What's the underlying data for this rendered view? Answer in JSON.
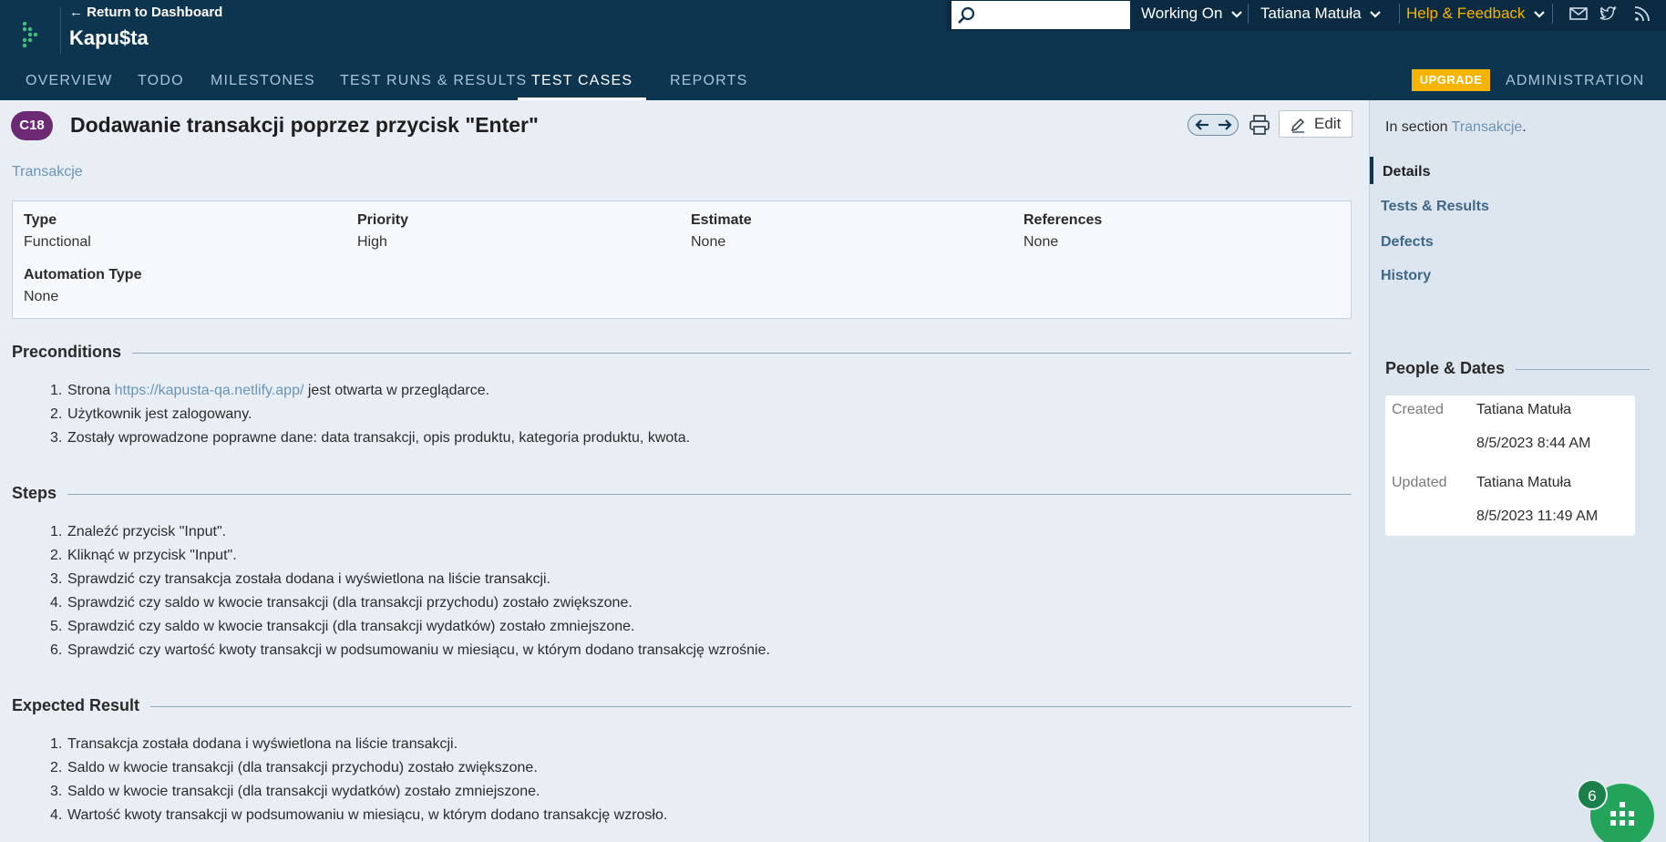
{
  "header": {
    "return_link": "← Return to Dashboard",
    "project_name": "Kapu$ta",
    "search": {
      "placeholder": ""
    },
    "menus": [
      {
        "label": "Working On"
      },
      {
        "label": "Tatiana Matuła"
      },
      {
        "label": "Help & Feedback"
      }
    ],
    "icons": [
      "mail-icon",
      "twitter-icon",
      "rss-icon"
    ],
    "nav": [
      {
        "label": "OVERVIEW"
      },
      {
        "label": "TODO"
      },
      {
        "label": "MILESTONES"
      },
      {
        "label": "TEST RUNS & RESULTS"
      },
      {
        "label": "TEST CASES",
        "active": true
      },
      {
        "label": "REPORTS"
      }
    ],
    "upgrade_label": "UPGRADE",
    "admin_label": "ADMINISTRATION"
  },
  "case": {
    "id": "C18",
    "title": "Dodawanie transakcji poprzez przycisk \"Enter\"",
    "edit_label": "Edit",
    "section": "Transakcje",
    "fields": {
      "type_label": "Type",
      "type_value": "Functional",
      "priority_label": "Priority",
      "priority_value": "High",
      "estimate_label": "Estimate",
      "estimate_value": "None",
      "references_label": "References",
      "references_value": "None",
      "automation_label": "Automation Type",
      "automation_value": "None"
    },
    "preconditions": {
      "heading": "Preconditions",
      "items": [
        {
          "num": "1.",
          "prefix": "Strona ",
          "link": "https://kapusta-qa.netlify.app/",
          "suffix": " jest otwarta w przeglądarce."
        },
        {
          "num": "2.",
          "text": "Użytkownik jest zalogowany."
        },
        {
          "num": "3.",
          "text": "Zostały wprowadzone poprawne dane: data transakcji, opis produktu, kategoria produktu, kwota."
        }
      ]
    },
    "steps": {
      "heading": "Steps",
      "items": [
        {
          "num": "1.",
          "text": "Znaleźć przycisk \"Input\"."
        },
        {
          "num": "2.",
          "text": "Kliknąć w przycisk \"Input\"."
        },
        {
          "num": "3.",
          "text": "Sprawdzić czy transakcja została dodana i wyświetlona na liście transakcji."
        },
        {
          "num": "4.",
          "text": "Sprawdzić czy saldo w kwocie transakcji (dla transakcji przychodu) zostało zwiększone."
        },
        {
          "num": "5.",
          "text": "Sprawdzić czy saldo w kwocie transakcji (dla transakcji wydatków) zostało zmniejszone."
        },
        {
          "num": "6.",
          "text": "Sprawdzić czy wartość kwoty transakcji w podsumowaniu w miesiącu, w którym dodano transakcję wzrośnie."
        }
      ]
    },
    "expected": {
      "heading": "Expected Result",
      "items": [
        {
          "num": "1.",
          "text": "Transakcja została dodana i wyświetlona na liście transakcji."
        },
        {
          "num": "2.",
          "text": "Saldo w kwocie transakcji (dla transakcji przychodu) zostało zwiększone."
        },
        {
          "num": "3.",
          "text": "Saldo w kwocie transakcji (dla transakcji wydatków) zostało zmniejszone."
        },
        {
          "num": "4.",
          "text": "Wartość kwoty transakcji w podsumowaniu w miesiącu, w którym dodano transakcję wzrosło."
        }
      ]
    }
  },
  "sidebar": {
    "in_section_prefix": "In section ",
    "in_section_link": "Transakcje",
    "in_section_suffix": ".",
    "tabs": [
      {
        "label": "Details",
        "active": true
      },
      {
        "label": "Tests & Results"
      },
      {
        "label": "Defects"
      },
      {
        "label": "History"
      }
    ],
    "people_heading": "People & Dates",
    "created_label": "Created",
    "created_by": "Tatiana Matuła",
    "created_at": "8/5/2023 8:44 AM",
    "updated_label": "Updated",
    "updated_by": "Tatiana Matuła",
    "updated_at": "8/5/2023 11:49 AM"
  },
  "widget": {
    "badge": "6"
  },
  "colors": {
    "header_bg": "#0e3550",
    "badge_purple": "#6d2a74",
    "link": "#6a94b8",
    "help_feedback": "#f6b400",
    "upgrade": "#f6b400",
    "widget_green": "#23a45a"
  }
}
